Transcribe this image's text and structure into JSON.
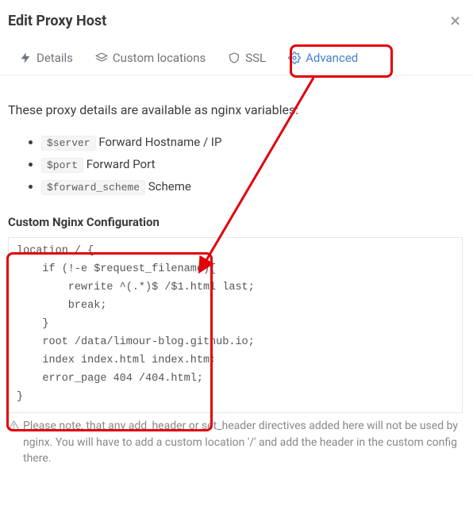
{
  "header": {
    "title": "Edit Proxy Host"
  },
  "tabs": {
    "details": "Details",
    "custom_locations": "Custom locations",
    "ssl": "SSL",
    "advanced": "Advanced"
  },
  "content": {
    "intro": "These proxy details are available as nginx variables:",
    "vars": [
      {
        "code": "$server",
        "label": " Forward Hostname / IP"
      },
      {
        "code": "$port",
        "label": " Forward Port"
      },
      {
        "code": "$forward_scheme",
        "label": " Scheme"
      }
    ],
    "config_label": "Custom Nginx Configuration",
    "config_value": "location / {\n    if (!-e $request_filename){\n        rewrite ^(.*)$ /$1.html last;\n        break;\n    }\n    root /data/limour-blog.github.io;\n    index index.html index.htm;\n    error_page 404 /404.html;\n}",
    "note": "Please note, that any add_header or set_header directives added here will not be used by nginx. You will have to add a custom location '/' and add the header in the custom config there."
  }
}
